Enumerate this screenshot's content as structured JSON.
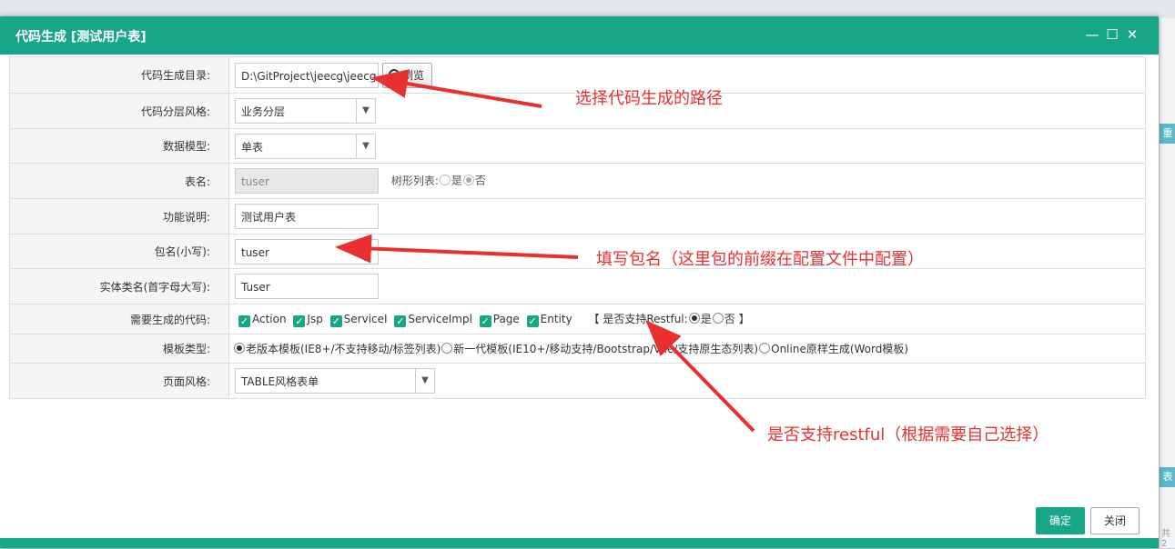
{
  "background": {
    "fragment_label_1": "重",
    "fragment_label_2": "表",
    "fragment_text": "共 2"
  },
  "dialog": {
    "title": "代码生成 [测试用户表]",
    "controls": {
      "minimize": "—",
      "maximize": "☐",
      "close": "✕"
    }
  },
  "form": {
    "output_dir": {
      "label": "代码生成目录:",
      "value": "D:\\GitProject\\jeecg\\jeecg",
      "browse_label": "浏览"
    },
    "layer_style": {
      "label": "代码分层风格:",
      "value": "业务分层"
    },
    "data_model": {
      "label": "数据模型:",
      "value": "单表"
    },
    "table_name": {
      "label": "表名:",
      "value": "tuser",
      "tree_label": "树形列表:",
      "yes": "是",
      "no": "否"
    },
    "description": {
      "label": "功能说明:",
      "value": "测试用户表"
    },
    "package_name": {
      "label": "包名(小写):",
      "value": "tuser"
    },
    "entity_name": {
      "label": "实体类名(首字母大写):",
      "value": "Tuser"
    },
    "generate_code": {
      "label": "需要生成的代码:",
      "options": [
        "Action",
        "Jsp",
        "ServiceI",
        "ServiceImpl",
        "Page",
        "Entity"
      ],
      "restful_open": "【 是否支持Restful:",
      "restful_yes": "是",
      "restful_no": "否",
      "restful_close": "】"
    },
    "template_type": {
      "label": "模板类型:",
      "options": [
        "老版本模板(IE8+/不支持移动/标签列表)",
        "新一代模板(IE10+/移动支持/Bootstrap/Vue/支持原生态列表)",
        "Online原样生成(Word模板)"
      ]
    },
    "page_style": {
      "label": "页面风格:",
      "value": "TABLE风格表单"
    }
  },
  "annotations": {
    "path": "选择代码生成的路径",
    "package": "填写包名（这里包的前缀在配置文件中配置）",
    "restful": "是否支持restful（根据需要自己选择）"
  },
  "buttons": {
    "ok": "确定",
    "close": "关闭"
  },
  "colors": {
    "primary": "#18a689",
    "annotation": "#e8302f"
  }
}
